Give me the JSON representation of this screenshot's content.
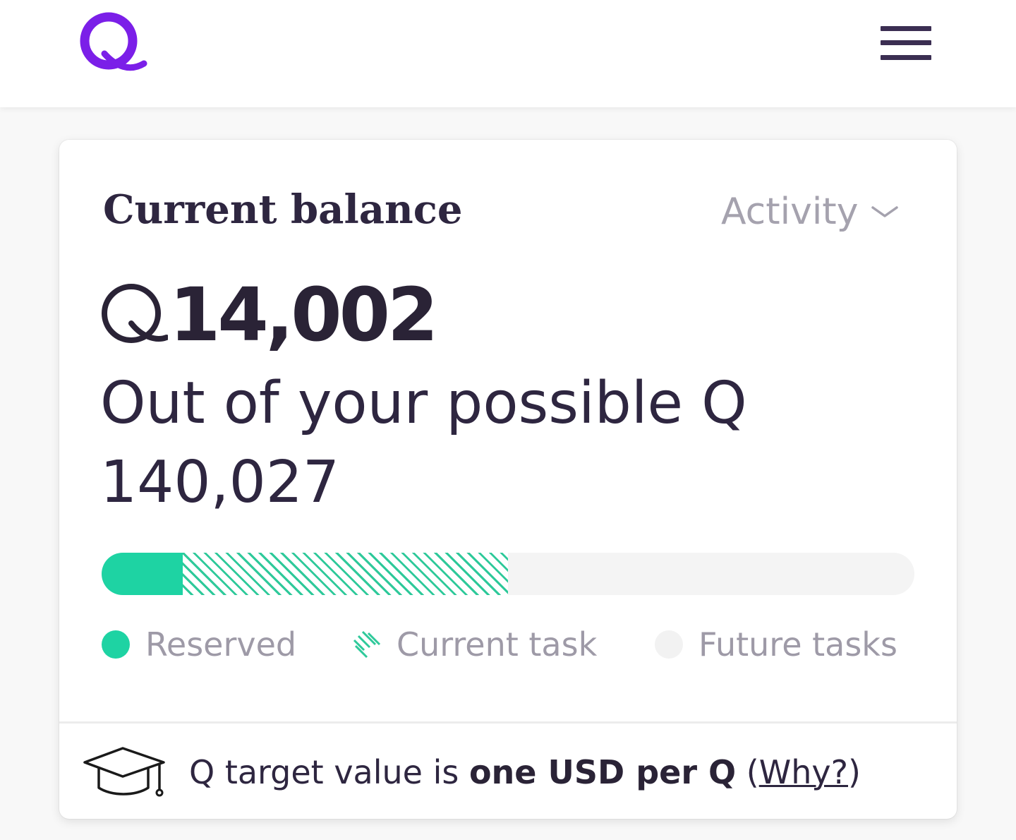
{
  "header": {
    "logo_icon": "q-logo-icon",
    "menu_icon": "hamburger-menu-icon",
    "brand_color": "#7b1fe8"
  },
  "balance_card": {
    "title": "Current balance",
    "activity_label": "Activity",
    "activity_icon": "chevron-down-icon",
    "balance_amount": "14,002",
    "currency_icon": "q-currency-icon",
    "possible_text": "Out of your possible Q 140,027",
    "progress": {
      "reserved_fraction": 0.1,
      "current_task_fraction": 0.4,
      "reserved_color": "#1ed3a3",
      "current_task_color": "#2ec99a",
      "future_color": "#f4f4f4"
    },
    "legend": [
      {
        "label": "Reserved",
        "icon": "reserved-dot-icon",
        "color": "#1ed3a3"
      },
      {
        "label": "Current task",
        "icon": "hatched-swatch-icon",
        "color": "#2ec99a"
      },
      {
        "label": "Future tasks",
        "icon": "future-dot-icon",
        "color": "#f2f2f2"
      }
    ],
    "footer": {
      "icon": "graduation-cap-icon",
      "prefix": "Q target value is ",
      "emphasis": "one USD per Q",
      "open_paren": " (",
      "link": "Why?",
      "close_paren": ")"
    }
  }
}
